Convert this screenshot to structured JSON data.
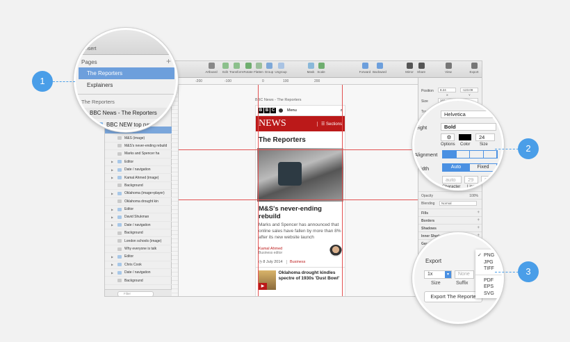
{
  "toolbar": {
    "tools": [
      "Artboard",
      "Edit",
      "Transform",
      "Rotate",
      "Flatten",
      "Group",
      "Ungroup",
      "Mask",
      "Scale",
      "Forward",
      "Backward",
      "Mirror",
      "Share",
      "View",
      "Export"
    ]
  },
  "ruler": {
    "ticks": [
      "-200",
      "-100",
      "0",
      "100",
      "200"
    ]
  },
  "layers": {
    "items": [
      {
        "label": "M&S (image)",
        "icon": "image-icon"
      },
      {
        "label": "M&S's never-ending rebuild",
        "icon": "text-icon"
      },
      {
        "label": "Marks and Spencer ha",
        "icon": "text-icon"
      },
      {
        "label": "Editor",
        "icon": "folder-icon"
      },
      {
        "label": "Date / navigation",
        "icon": "folder-icon"
      },
      {
        "label": "Kamal Ahmed (image)",
        "icon": "folder-icon"
      },
      {
        "label": "Background",
        "icon": "shape-icon"
      },
      {
        "label": "Oklahoma (image+player)",
        "icon": "folder-icon"
      },
      {
        "label": "Oklahoma drought kin",
        "icon": "text-icon"
      },
      {
        "label": "Editor",
        "icon": "folder-icon"
      },
      {
        "label": "David Shukman",
        "icon": "folder-icon"
      },
      {
        "label": "Date / navigation",
        "icon": "folder-icon"
      },
      {
        "label": "Background",
        "icon": "shape-icon"
      },
      {
        "label": "London schools (image)",
        "icon": "image-icon"
      },
      {
        "label": "Why everyone is talk",
        "icon": "text-icon"
      },
      {
        "label": "Editor",
        "icon": "folder-icon"
      },
      {
        "label": "Chris Cook",
        "icon": "folder-icon"
      },
      {
        "label": "Date / navigation",
        "icon": "folder-icon"
      },
      {
        "label": "Background",
        "icon": "shape-icon"
      }
    ],
    "filter_placeholder": "Filter"
  },
  "artboard": {
    "title": "BBC News - The Reporters",
    "bbc_logo": [
      "B",
      "B",
      "C"
    ],
    "menu_label": "Menu",
    "news_logo": "NEWS",
    "sections_label": "Sections",
    "section_title": "The Reporters",
    "headline": "M&S's never-ending rebuild",
    "summary": "Marks and Spencer has announced that online sales have fallen by more than 8% after its new website launch",
    "author_name": "Kamal Ahmed",
    "author_role": "Business editor",
    "date": "8 July 2014",
    "category": "Business",
    "story2_title": "Oklahoma drought kindles spectre of 1930s 'Dust Bowl'"
  },
  "inspector": {
    "position_label": "Position",
    "position_x": "8.24",
    "position_y": "-123.09",
    "x_label": "X",
    "y_label": "Y",
    "size_label": "Size",
    "size_w": "160",
    "transform_label": "Transf",
    "sections": [
      "Opacity",
      "Blending",
      "Fills",
      "Borders",
      "Shadows",
      "Inner Shadows",
      "Gaussian"
    ],
    "opacity_value": "100%",
    "blending_value": "Normal"
  },
  "mag1": {
    "insert_label": "Insert",
    "pages_label": "Pages",
    "pages": [
      "The Reporters",
      "Explainers"
    ],
    "artboards_header": "The Reporters",
    "artboard_group": "BBC News - The Reporters",
    "nav_item": "BBC NEW top nav"
  },
  "mag2": {
    "font": "Helvetica",
    "weight_label": "eight",
    "weight": "Bold",
    "options_label": "Options",
    "color_label": "Color",
    "size_label": "Size",
    "size": "24",
    "alignment_label": "Alignment",
    "width_label": "Width",
    "width_options": [
      "Auto",
      "Fixed"
    ],
    "spacing_label": "acing",
    "character_value": "auto",
    "line_value": "29",
    "paragraph_value": "0",
    "character_label": "Character",
    "line_label": "Line",
    "paragraph_label": "P"
  },
  "mag3": {
    "title": "Export",
    "formats": [
      "PNG",
      "JPG",
      "TIFF",
      "PDF",
      "EPS",
      "SVG"
    ],
    "selected_format": "PNG",
    "scale": "1x",
    "suffix_placeholder": "None",
    "size_label": "Size",
    "suffix_label": "Suffix",
    "export_button": "Export The Reporte"
  },
  "callouts": [
    "1",
    "2",
    "3"
  ],
  "colors": {
    "accent": "#4a9ee8",
    "bbc_red": "#bb1919",
    "selection": "#6d9fdc"
  }
}
